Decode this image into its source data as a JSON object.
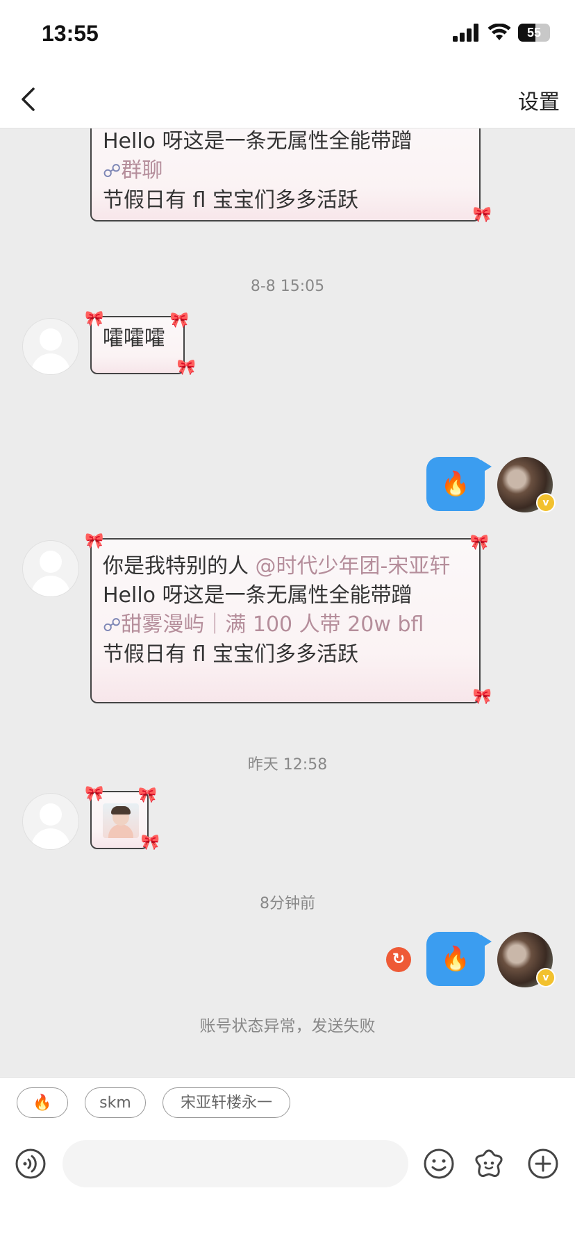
{
  "status_bar": {
    "time": "13:55",
    "battery": "55",
    "battery_level_percent": 55
  },
  "nav": {
    "settings_label": "设置"
  },
  "messages": {
    "partial_top": {
      "line1": "Hello 呀这是一条无属性全能带蹭",
      "group": "群聊",
      "line3": "节假日有 fl 宝宝们多多活跃"
    },
    "ts1": "8-8 15:05",
    "msg_oh": "嚯嚯嚯",
    "self_fire_1": "🔥",
    "long_msg": {
      "line1": "你是我特别的人 ",
      "mention": "@时代少年团-宋亚轩",
      "line2": "Hello 呀这是一条无属性全能带蹭",
      "group": "甜雾漫屿｜满 100 人带 20w bfl",
      "line3": "节假日有 fl 宝宝们多多活跃"
    },
    "ts2": "昨天 12:58",
    "ts3": "8分钟前",
    "self_fire_2": "🔥",
    "error_text": "账号状态异常，发送失败"
  },
  "quick_replies": [
    "🔥",
    "skm",
    "宋亚轩楼永一"
  ],
  "input": {
    "placeholder": ""
  },
  "icons": {
    "back": "chevron-left-icon",
    "voice": "voice-icon",
    "emoji": "emoji-icon",
    "sticker": "flower-sticker-icon",
    "plus": "plus-icon",
    "resend": "resend-icon"
  },
  "colors": {
    "self_bubble": "#3b9df0",
    "error": "#ee5a36",
    "mention": "#b58e9b"
  }
}
